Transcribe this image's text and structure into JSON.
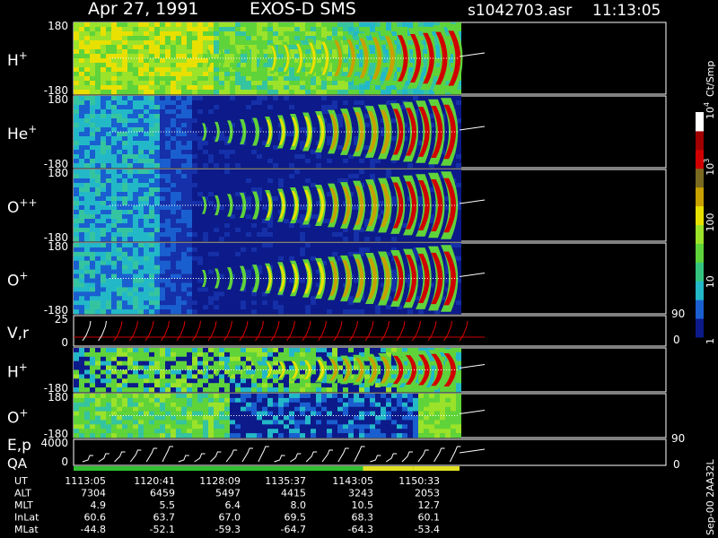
{
  "header": {
    "date": "Apr 27, 1991",
    "instrument": "EXOS-D SMS",
    "file": "s1042703.asr",
    "time": "11:13:05"
  },
  "colorbar": {
    "title": "Ct/Smp",
    "labels": [
      {
        "value": 10000,
        "text": "10",
        "sup": "4"
      },
      {
        "value": 1000,
        "text": "10",
        "sup": "3"
      },
      {
        "value": 100,
        "text": "100",
        "sup": ""
      },
      {
        "value": 10,
        "text": "10",
        "sup": ""
      },
      {
        "value": 1,
        "text": "1",
        "sup": ""
      }
    ],
    "colors": [
      "#0c1a8a",
      "#1a5fd0",
      "#23b8c8",
      "#35c47f",
      "#5fd33a",
      "#9be22a",
      "#e8e000",
      "#c8a000",
      "#7a6a20",
      "#d00000",
      "#a00000",
      "#ffffff"
    ]
  },
  "side_notes": {
    "mid_upper": "90",
    "mid_lower": "0",
    "low_upper": "90",
    "low_lower": "0",
    "vertical_id": "Sep-00 2AA32L"
  },
  "chart_data": {
    "type": "heatmap",
    "panels": [
      {
        "id": "h_plus_1",
        "label": "H",
        "sup": "+",
        "ymax": "180",
        "ymin": "-180",
        "style": "hp"
      },
      {
        "id": "he_plus",
        "label": "He",
        "sup": "+",
        "ymax": "180",
        "ymin": "-180",
        "style": "ion"
      },
      {
        "id": "o_plusplus",
        "label": "O",
        "sup": "++",
        "ymax": "180",
        "ymin": "-180",
        "style": "ion"
      },
      {
        "id": "o_plus_1",
        "label": "O",
        "sup": "+",
        "ymax": "180",
        "ymin": "-180",
        "style": "ion"
      },
      {
        "id": "vr",
        "label": "V,r",
        "sup": "",
        "ymax": "25",
        "ymin": "0",
        "style": "vr"
      },
      {
        "id": "h_plus_2",
        "label": "H",
        "sup": "+",
        "ymax": "",
        "ymin": "-180",
        "style": "hp2"
      },
      {
        "id": "o_plus_2",
        "label": "O",
        "sup": "+",
        "ymax": "180",
        "ymin": "-180",
        "style": "op2"
      },
      {
        "id": "ep",
        "label": "E,p",
        "sub_label": "QA",
        "sup": "",
        "ymax": "4000",
        "ymin": "0",
        "style": "ep"
      }
    ],
    "x_ticks": [
      "1113:05",
      "1120:41",
      "1128:09",
      "1135:37",
      "1143:05",
      "1150:33"
    ],
    "orbit_table": {
      "rows": [
        {
          "name": "UT",
          "values": [
            "1113:05",
            "1120:41",
            "1128:09",
            "1135:37",
            "1143:05",
            "1150:33"
          ]
        },
        {
          "name": "ALT",
          "values": [
            "7304",
            "6459",
            "5497",
            "4415",
            "3243",
            "2053"
          ]
        },
        {
          "name": "MLT",
          "values": [
            "4.9",
            "5.5",
            "6.4",
            "8.0",
            "10.5",
            "12.7"
          ]
        },
        {
          "name": "InLat",
          "values": [
            "60.6",
            "63.7",
            "67.0",
            "69.5",
            "68.3",
            "60.1"
          ]
        },
        {
          "name": "MLat",
          "values": [
            "-44.8",
            "-52.1",
            "-59.3",
            "-64.7",
            "-64.3",
            "-53.4"
          ]
        }
      ]
    },
    "qa_bar": [
      {
        "from": 0,
        "to": 0.75,
        "color": "#30c030"
      },
      {
        "from": 0.75,
        "to": 0.88,
        "color": "#e0e020"
      },
      {
        "from": 0.88,
        "to": 1.0,
        "color": "#e0e020"
      }
    ]
  }
}
